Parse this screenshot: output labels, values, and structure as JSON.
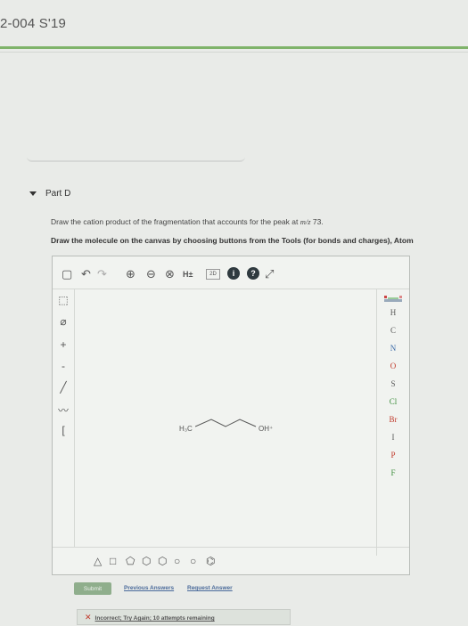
{
  "header": {
    "course_title": "2-004 S'19"
  },
  "part": {
    "label": "Part D"
  },
  "question": {
    "prefix": "Draw the cation product of the fragmentation that accounts for the peak at ",
    "mz_label": "m/z",
    "mz_value": " 73.",
    "instruction": "Draw the molecule on the canvas by choosing buttons from the Tools (for bonds and charges), Atom"
  },
  "toolbar": {
    "h_toggle": "H±",
    "two_d": "2D",
    "info": "i",
    "help": "?"
  },
  "left_tools": {
    "plus": "+",
    "minus": "-"
  },
  "elements": [
    "H",
    "C",
    "N",
    "O",
    "S",
    "Cl",
    "Br",
    "I",
    "P",
    "F"
  ],
  "molecule": {
    "left_label": "H₃C",
    "right_label": "OH⁺"
  },
  "actions": {
    "submit": "Submit",
    "previous_answers": "Previous Answers",
    "request_answer": "Request Answer"
  },
  "feedback": {
    "message": "Incorrect; Try Again; 10 attempts remaining"
  },
  "colors": {
    "accent_green": "#7fb36a",
    "error_red": "#c0392b",
    "link_blue": "#4a6a9a"
  }
}
